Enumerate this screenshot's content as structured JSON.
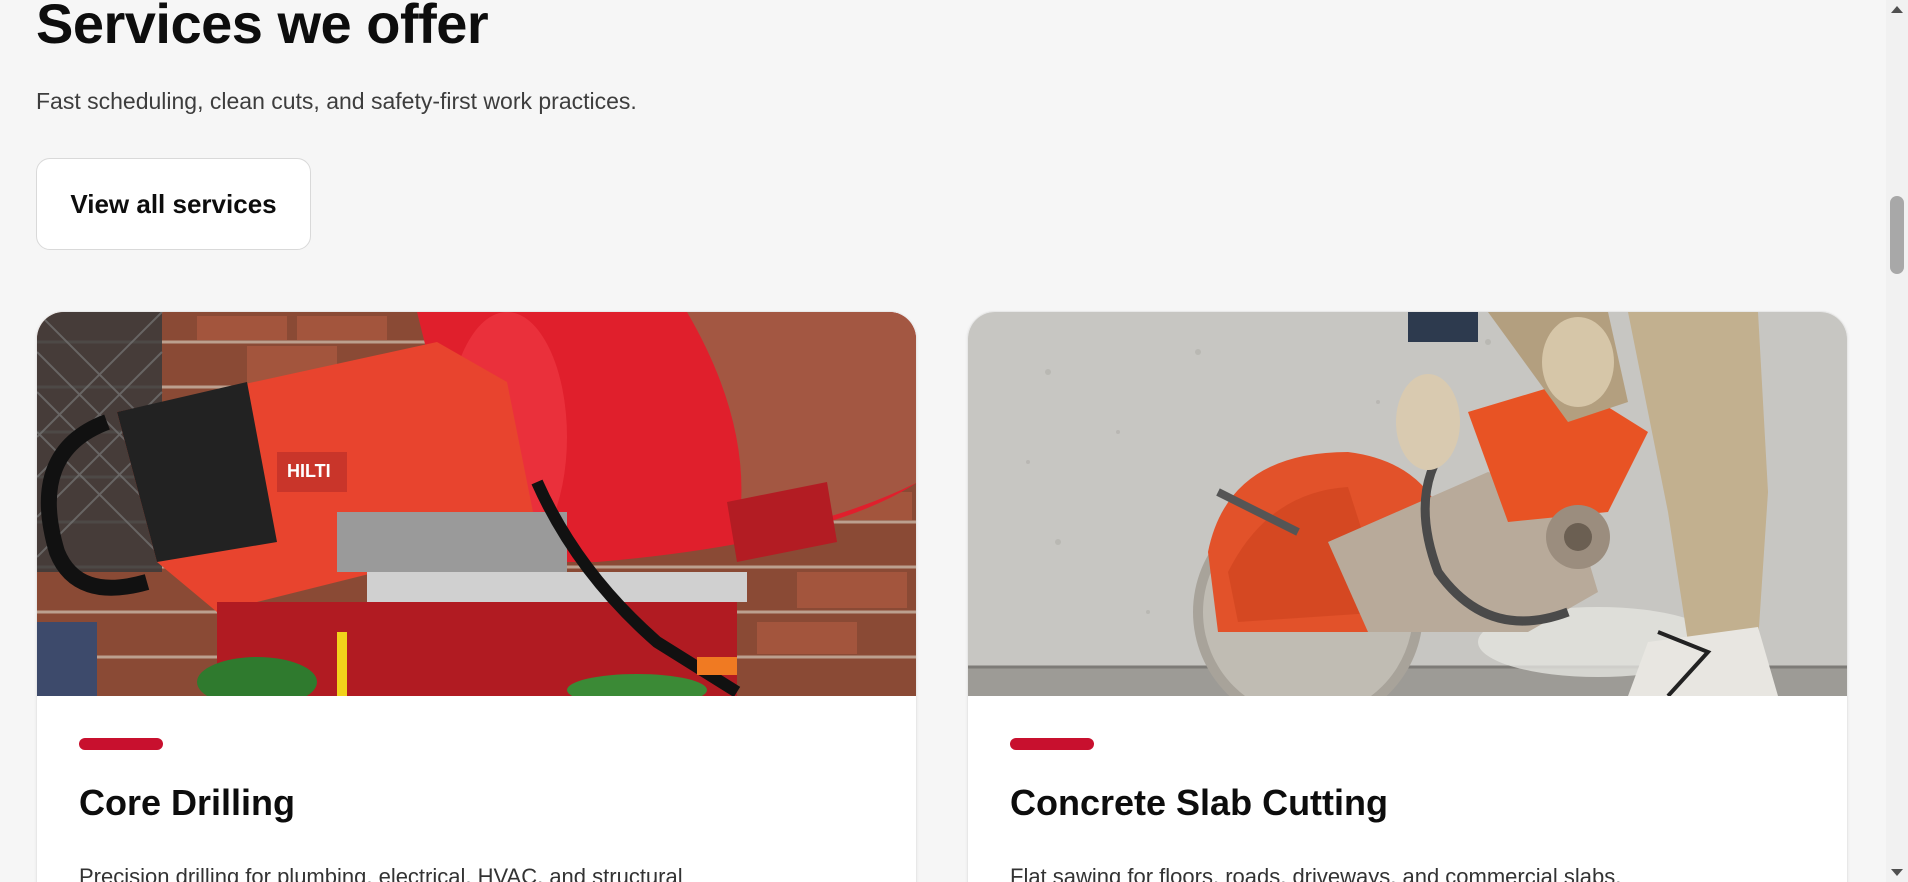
{
  "section": {
    "title": "Services we offer",
    "subtitle": "Fast scheduling, clean cuts, and safety-first work practices.",
    "view_all_label": "View all services"
  },
  "cards": [
    {
      "title": "Core Drilling",
      "description": "Precision drilling for plumbing, electrical, HVAC, and structural",
      "image": "core-drill-rig-photo"
    },
    {
      "title": "Concrete Slab Cutting",
      "description": "Flat sawing for floors, roads, driveways, and commercial slabs.",
      "image": "concrete-saw-photo"
    }
  ],
  "colors": {
    "accent": "#c8102e",
    "background": "#f6f6f6",
    "card": "#ffffff"
  }
}
